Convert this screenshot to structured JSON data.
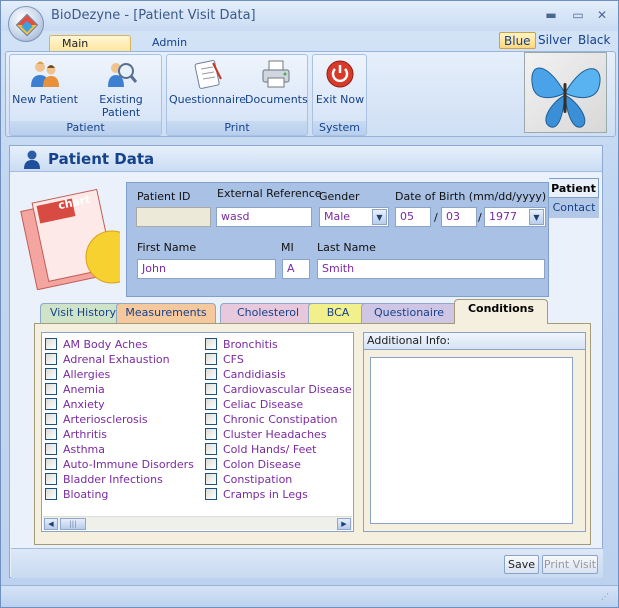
{
  "window": {
    "title": "BioDezyne - [Patient Visit Data]",
    "minimize": "▬",
    "maximize": "▭",
    "close": "✕"
  },
  "ribbon": {
    "tabs": [
      {
        "label": "Main Menu"
      },
      {
        "label": "Admin"
      }
    ],
    "themes": [
      {
        "label": "Blue"
      },
      {
        "label": "Silver"
      },
      {
        "label": "Black"
      }
    ],
    "groups": [
      {
        "label": "Patient",
        "buttons": [
          {
            "label": "New Patient",
            "icon": "users-icon"
          },
          {
            "label": "Existing Patient",
            "icon": "search-user-icon"
          }
        ]
      },
      {
        "label": "Print",
        "buttons": [
          {
            "label": "Questionnaire",
            "icon": "clipboard-icon"
          },
          {
            "label": "Documents",
            "icon": "printer-icon"
          }
        ]
      },
      {
        "label": "System",
        "buttons": [
          {
            "label": "Exit Now",
            "icon": "power-icon"
          }
        ]
      }
    ]
  },
  "panel": {
    "title": "Patient Data",
    "chart_icon_label": "chart",
    "side_tabs": [
      {
        "label": "Patient"
      },
      {
        "label": "Contact"
      }
    ],
    "fields": {
      "patient_id": {
        "label": "Patient ID",
        "value": ""
      },
      "external_reference": {
        "label": "External Reference",
        "value": "wasd"
      },
      "gender": {
        "label": "Gender",
        "value": "Male"
      },
      "dob": {
        "label": "Date of Birth (mm/dd/yyyy)",
        "month": "05",
        "day": "03",
        "year": "1977",
        "separator": "/"
      },
      "first_name": {
        "label": "First Name",
        "value": "John"
      },
      "mi": {
        "label": "MI",
        "value": "A"
      },
      "last_name": {
        "label": "Last Name",
        "value": "Smith"
      }
    },
    "tabs": [
      {
        "label": "Visit History",
        "color": "#cfe3c9"
      },
      {
        "label": "Measurements",
        "color": "#f6c89e"
      },
      {
        "label": "Cholesterol",
        "color": "#e8c8dc"
      },
      {
        "label": "BCA",
        "color": "#f1f08a"
      },
      {
        "label": "Questionaire",
        "color": "#cfc6e6"
      },
      {
        "label": "Conditions",
        "color": "#f4efde"
      }
    ],
    "conditions_col1": [
      "AM Body Aches",
      "Adrenal Exhaustion",
      "Allergies",
      "Anemia",
      "Anxiety",
      "Arteriosclerosis",
      "Arthritis",
      "Asthma",
      "Auto-Immune Disorders",
      "Bladder Infections",
      "Bloating"
    ],
    "conditions_col2": [
      "Bronchitis",
      "CFS",
      "Candidiasis",
      "Cardiovascular Disease",
      "Celiac Disease",
      "Chronic Constipation",
      "Cluster Headaches",
      "Cold Hands/ Feet",
      "Colon Disease",
      "Constipation",
      "Cramps in Legs"
    ],
    "additional_info": {
      "label": "Additional Info:",
      "value": ""
    },
    "footer": {
      "save": "Save",
      "print_visit": "Print Visit"
    }
  }
}
